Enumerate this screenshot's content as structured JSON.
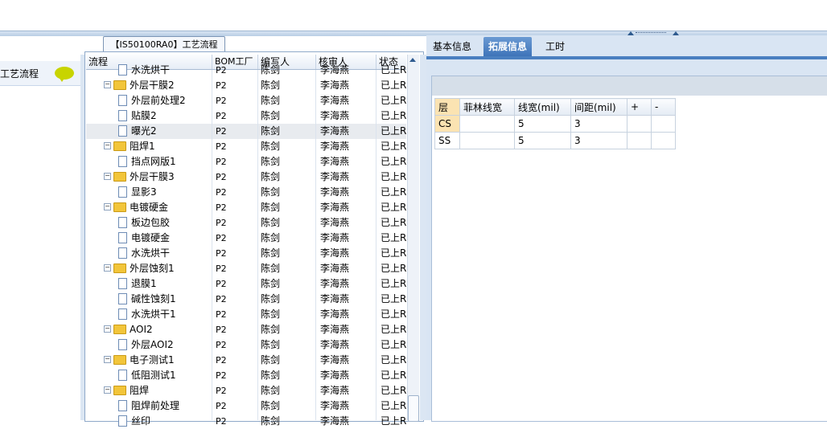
{
  "group_tab": "【IS50100RA0】工艺流程",
  "left_panel": {
    "item_label": "工艺流程",
    "item_icon": "speech-bubble-icon"
  },
  "columns": [
    "流程",
    "BOM工厂",
    "编写人",
    "核审人",
    "状态"
  ],
  "rows": [
    {
      "name": "水洗烘干",
      "kind": "doc",
      "level": 2,
      "factory": "P2",
      "writer": "陈剑",
      "reviewer": "李海燕",
      "status": "已上R"
    },
    {
      "name": "外层干膜2",
      "kind": "folder",
      "level": 1,
      "factory": "P2",
      "writer": "陈剑",
      "reviewer": "李海燕",
      "status": "已上R"
    },
    {
      "name": "外层前处理2",
      "kind": "doc",
      "level": 2,
      "factory": "P2",
      "writer": "陈剑",
      "reviewer": "李海燕",
      "status": "已上R"
    },
    {
      "name": "贴膜2",
      "kind": "doc",
      "level": 2,
      "factory": "P2",
      "writer": "陈剑",
      "reviewer": "李海燕",
      "status": "已上R"
    },
    {
      "name": "曝光2",
      "kind": "doc",
      "level": 2,
      "factory": "P2",
      "writer": "陈剑",
      "reviewer": "李海燕",
      "status": "已上R",
      "selected": true
    },
    {
      "name": "阻焊1",
      "kind": "folder",
      "level": 1,
      "factory": "P2",
      "writer": "陈剑",
      "reviewer": "李海燕",
      "status": "已上R"
    },
    {
      "name": "挡点网版1",
      "kind": "doc",
      "level": 2,
      "factory": "P2",
      "writer": "陈剑",
      "reviewer": "李海燕",
      "status": "已上R"
    },
    {
      "name": "外层干膜3",
      "kind": "folder",
      "level": 1,
      "factory": "P2",
      "writer": "陈剑",
      "reviewer": "李海燕",
      "status": "已上R"
    },
    {
      "name": "显影3",
      "kind": "doc",
      "level": 2,
      "factory": "P2",
      "writer": "陈剑",
      "reviewer": "李海燕",
      "status": "已上R"
    },
    {
      "name": "电镀硬金",
      "kind": "folder",
      "level": 1,
      "factory": "P2",
      "writer": "陈剑",
      "reviewer": "李海燕",
      "status": "已上R"
    },
    {
      "name": "板边包胶",
      "kind": "doc",
      "level": 2,
      "factory": "P2",
      "writer": "陈剑",
      "reviewer": "李海燕",
      "status": "已上R"
    },
    {
      "name": "电镀硬金",
      "kind": "doc",
      "level": 2,
      "factory": "P2",
      "writer": "陈剑",
      "reviewer": "李海燕",
      "status": "已上R"
    },
    {
      "name": "水洗烘干",
      "kind": "doc",
      "level": 2,
      "factory": "P2",
      "writer": "陈剑",
      "reviewer": "李海燕",
      "status": "已上R"
    },
    {
      "name": "外层蚀刻1",
      "kind": "folder",
      "level": 1,
      "factory": "P2",
      "writer": "陈剑",
      "reviewer": "李海燕",
      "status": "已上R"
    },
    {
      "name": "退膜1",
      "kind": "doc",
      "level": 2,
      "factory": "P2",
      "writer": "陈剑",
      "reviewer": "李海燕",
      "status": "已上R"
    },
    {
      "name": "碱性蚀刻1",
      "kind": "doc",
      "level": 2,
      "factory": "P2",
      "writer": "陈剑",
      "reviewer": "李海燕",
      "status": "已上R"
    },
    {
      "name": "水洗烘干1",
      "kind": "doc",
      "level": 2,
      "factory": "P2",
      "writer": "陈剑",
      "reviewer": "李海燕",
      "status": "已上R"
    },
    {
      "name": "AOI2",
      "kind": "folder",
      "level": 1,
      "factory": "P2",
      "writer": "陈剑",
      "reviewer": "李海燕",
      "status": "已上R"
    },
    {
      "name": "外层AOI2",
      "kind": "doc",
      "level": 2,
      "factory": "P2",
      "writer": "陈剑",
      "reviewer": "李海燕",
      "status": "已上R"
    },
    {
      "name": "电子测试1",
      "kind": "folder",
      "level": 1,
      "factory": "P2",
      "writer": "陈剑",
      "reviewer": "李海燕",
      "status": "已上R"
    },
    {
      "name": "低阻测试1",
      "kind": "doc",
      "level": 2,
      "factory": "P2",
      "writer": "陈剑",
      "reviewer": "李海燕",
      "status": "已上R"
    },
    {
      "name": "阻焊",
      "kind": "folder",
      "level": 1,
      "factory": "P2",
      "writer": "陈剑",
      "reviewer": "李海燕",
      "status": "已上R"
    },
    {
      "name": "阻焊前处理",
      "kind": "doc",
      "level": 2,
      "factory": "P2",
      "writer": "陈剑",
      "reviewer": "李海燕",
      "status": "已上R"
    },
    {
      "name": "丝印",
      "kind": "doc",
      "level": 2,
      "factory": "P2",
      "writer": "陈剑",
      "reviewer": "李海燕",
      "status": "已上R"
    }
  ],
  "right_tabs": [
    {
      "label": "基本信息",
      "active": false
    },
    {
      "label": "拓展信息",
      "active": true
    },
    {
      "label": "工时",
      "active": false
    }
  ],
  "ext_table": {
    "headers": [
      "层",
      "菲林线宽",
      "线宽(mil)",
      "间距(mil)",
      "+",
      "-"
    ],
    "rows": [
      [
        "CS",
        "",
        "5",
        "3",
        "",
        ""
      ],
      [
        "SS",
        "",
        "5",
        "3",
        "",
        ""
      ]
    ]
  },
  "colors": {
    "selection": "#e8ebef",
    "tab_active": "#3e74b9",
    "folder": "#f2c53a",
    "highlight": "#fbe3b2"
  }
}
